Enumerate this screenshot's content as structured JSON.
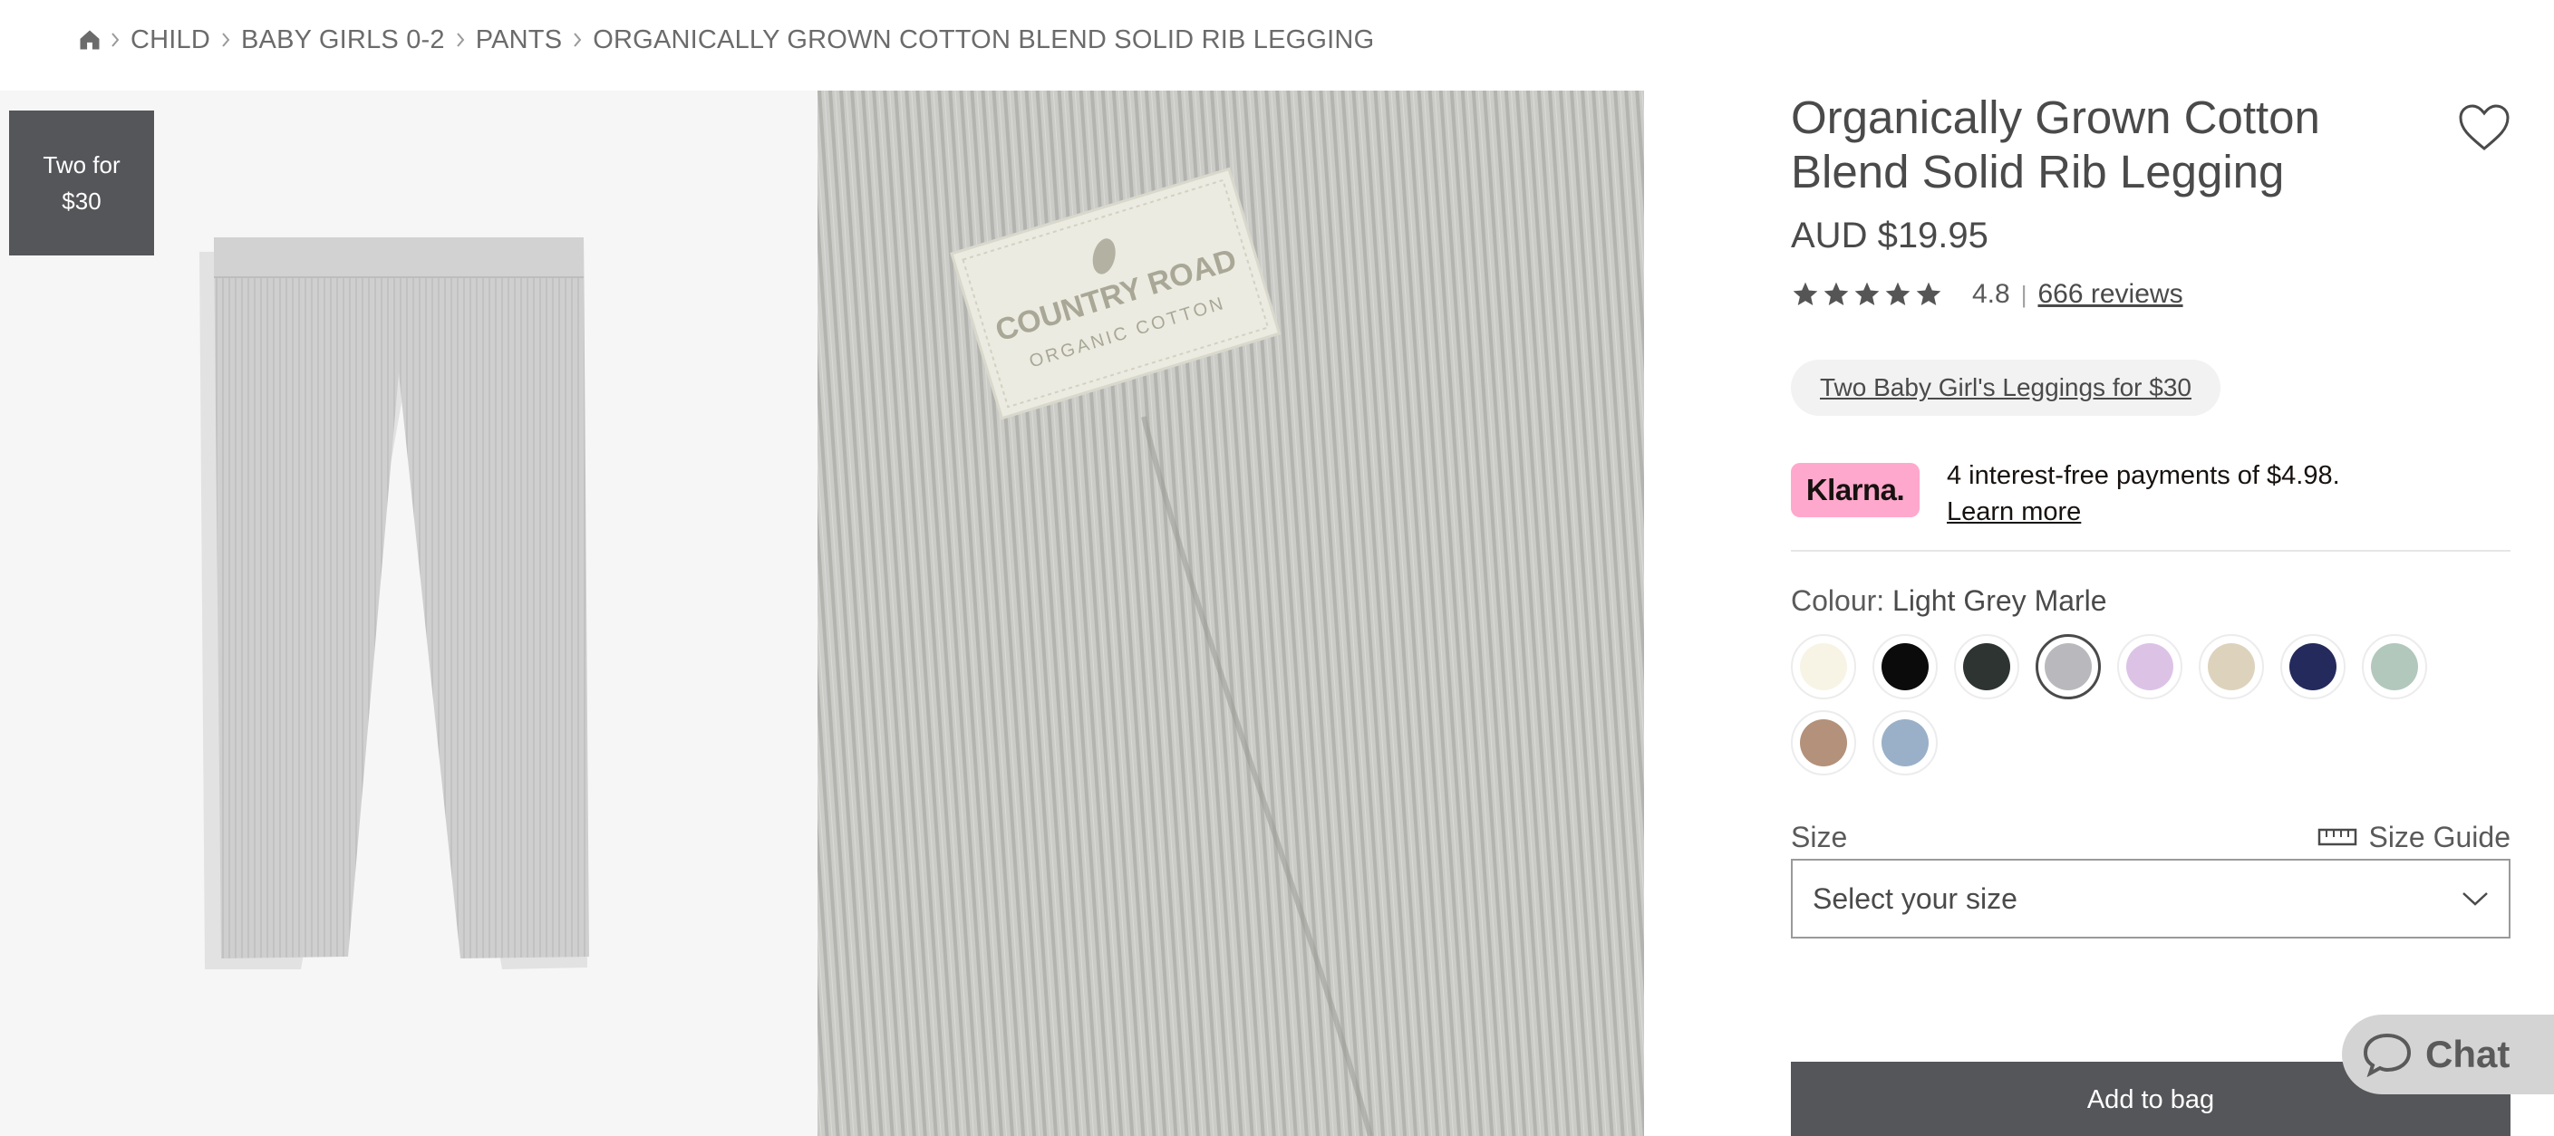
{
  "breadcrumb": {
    "home_icon": "home-icon",
    "items": [
      "CHILD",
      "BABY GIRLS 0-2",
      "PANTS",
      "ORGANICALLY GROWN COTTON BLEND SOLID RIB LEGGING"
    ]
  },
  "gallery": {
    "promo_badge": "Two for $30",
    "label_brand": "COUNTRY ROAD",
    "label_sub": "ORGANIC COTTON"
  },
  "product": {
    "title": "Organically Grown Cotton Blend Solid Rib Legging",
    "price": "AUD $19.95",
    "rating_value": "4.8",
    "rating_stars": 5,
    "rating_separator": "|",
    "reviews_label": "666 reviews",
    "promo_link": "Two Baby Girl's Leggings for $30"
  },
  "klarna": {
    "logo_text": "Klarna.",
    "message": "4 interest-free payments of $4.98.",
    "learn_more": "Learn more",
    "color": "#ffa8cd"
  },
  "colour": {
    "label": "Colour:",
    "selected": "Light Grey Marle",
    "swatches": [
      {
        "hex": "#f7f4e6",
        "selected": false
      },
      {
        "hex": "#0b0b0b",
        "selected": false
      },
      {
        "hex": "#2e3431",
        "selected": false
      },
      {
        "hex": "#b9b9bd",
        "selected": true
      },
      {
        "hex": "#dcc3e6",
        "selected": false
      },
      {
        "hex": "#ddd3bd",
        "selected": false
      },
      {
        "hex": "#242a5c",
        "selected": false
      },
      {
        "hex": "#b3c8bd",
        "selected": false
      },
      {
        "hex": "#b3917a",
        "selected": false
      },
      {
        "hex": "#9ab0c8",
        "selected": false
      }
    ]
  },
  "size": {
    "label": "Size",
    "guide_label": "Size Guide",
    "placeholder": "Select your size"
  },
  "actions": {
    "add_to_bag": "Add to bag",
    "chat": "Chat"
  }
}
